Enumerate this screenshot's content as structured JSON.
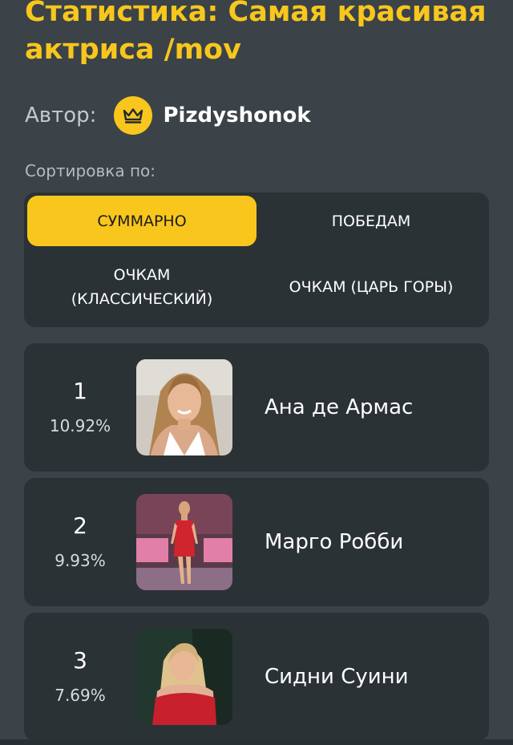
{
  "poll": {
    "title": "Статистика: Самая красивая актриса /mov"
  },
  "author": {
    "label": "Автор:",
    "name": "Pizdyshonok",
    "avatar_icon": "crown-icon"
  },
  "sort": {
    "label": "Сортировка по:",
    "options": [
      {
        "label": "СУММАРНО",
        "active": true
      },
      {
        "label": "ПОБЕДАМ",
        "active": false
      },
      {
        "label": "ОЧКАМ\n(КЛАССИЧЕСКИЙ)",
        "active": false
      },
      {
        "label": "ОЧКАМ (ЦАРЬ ГОРЫ)",
        "active": false
      }
    ]
  },
  "results": [
    {
      "rank": "1",
      "percent": "10.92%",
      "name": "Ана де Армас"
    },
    {
      "rank": "2",
      "percent": "9.93%",
      "name": "Марго Робби"
    },
    {
      "rank": "3",
      "percent": "7.69%",
      "name": "Сидни Суини"
    }
  ],
  "colors": {
    "background": "#3b4348",
    "panel": "#2b3236",
    "accent": "#f8c61d"
  }
}
